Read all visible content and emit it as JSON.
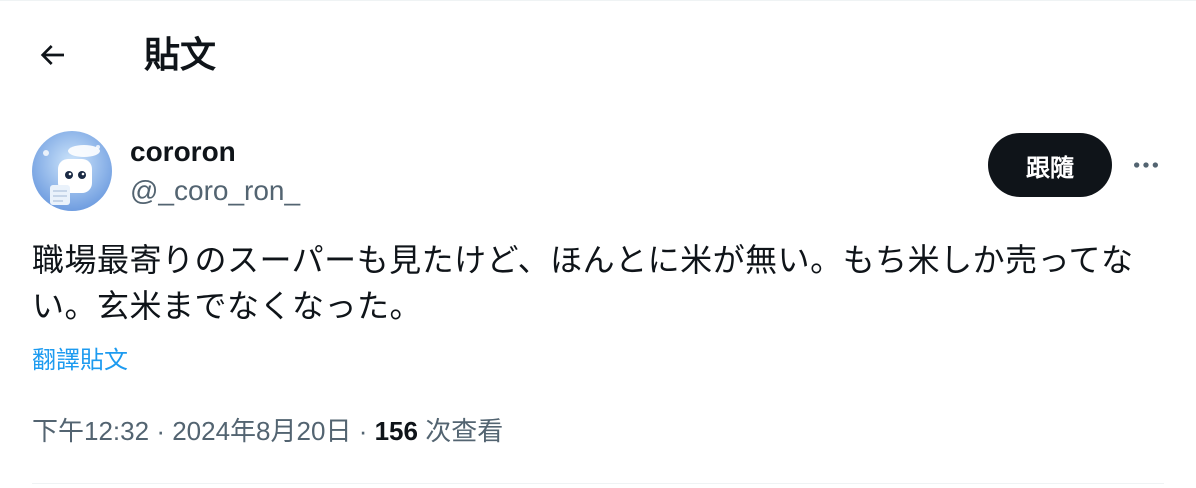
{
  "header": {
    "title": "貼文",
    "back_icon": "arrow-left-icon"
  },
  "author": {
    "display_name": "cororon",
    "handle": "@_coro_ron_",
    "avatar_icon": "avatar-image",
    "follow_label": "跟隨",
    "more_icon": "more-horizontal-icon"
  },
  "tweet": {
    "text": "職場最寄りのスーパーも見たけど、ほんとに米が無い。もち米しか売ってない。玄米までなくなった。",
    "translate_label": "翻譯貼文",
    "time": "下午12:32",
    "separator": "·",
    "date": "2024年8月20日",
    "views_count": "156",
    "views_label": "次查看"
  },
  "colors": {
    "text": "#0f1419",
    "secondary": "#536471",
    "link": "#1d9bf0",
    "button_bg": "#0f1419",
    "divider": "#eff3f4"
  }
}
